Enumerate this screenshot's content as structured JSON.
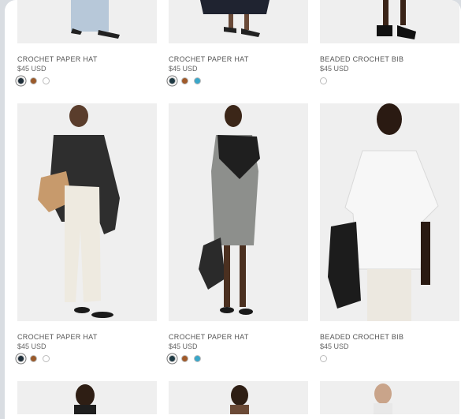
{
  "products": [
    {
      "name": "CROCHET PAPER HAT",
      "price": "$45 USD",
      "swatches": [
        "#1f2f3a",
        "#9a5a2a",
        "#ffffff"
      ]
    },
    {
      "name": "CROCHET PAPER HAT",
      "price": "$45 USD",
      "swatches": [
        "#1f3a44",
        "#a05a2a",
        "#3aa7c9"
      ]
    },
    {
      "name": "BEADED CROCHET BIB",
      "price": "$45 USD",
      "swatches": [
        "#ffffff"
      ]
    },
    {
      "name": "CROCHET PAPER HAT",
      "price": "$45 USD",
      "swatches": [
        "#1f2f3a",
        "#9a5a2a",
        "#ffffff"
      ]
    },
    {
      "name": "CROCHET PAPER HAT",
      "price": "$45 USD",
      "swatches": [
        "#1f3a44",
        "#a05a2a",
        "#3aa7c9"
      ]
    },
    {
      "name": "BEADED CROCHET BIB",
      "price": "$45 USD",
      "swatches": [
        "#ffffff"
      ]
    }
  ],
  "icons": {
    "model_photo": "person-photo"
  },
  "colors": {
    "background": "#ffffff",
    "image_bg": "#efefef"
  }
}
